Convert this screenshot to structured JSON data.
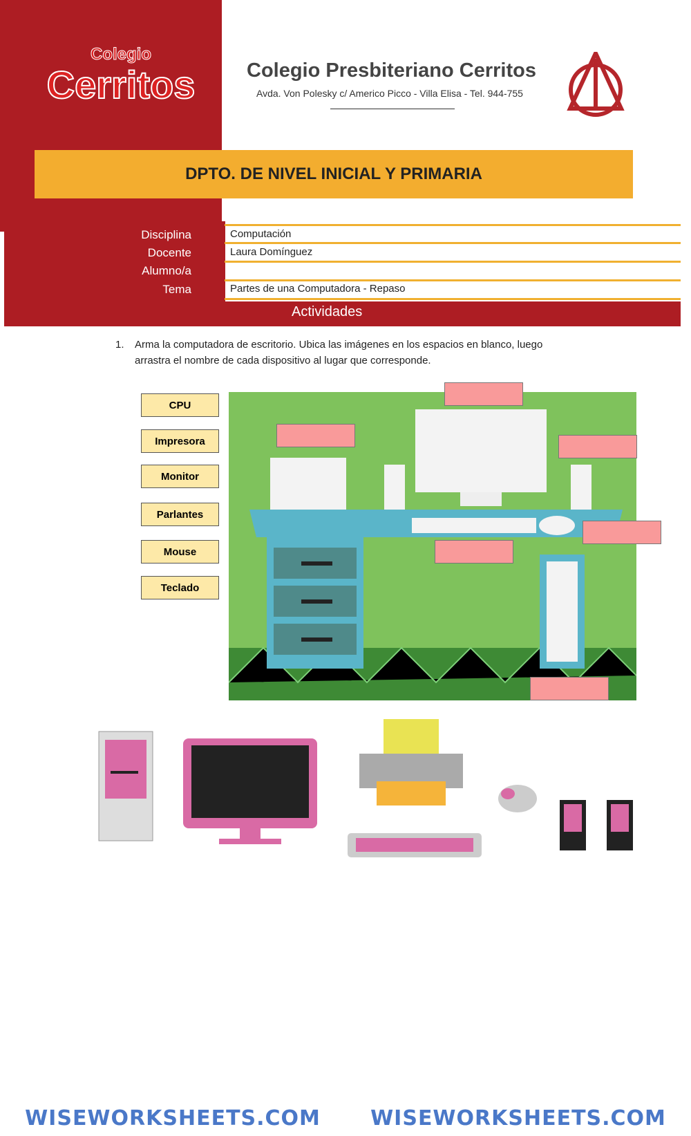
{
  "header": {
    "logo_text_small": "Colegio",
    "logo_text_big": "Cerritos",
    "school_name": "Colegio Presbiteriano Cerritos",
    "address": "Avda. Von Polesky c/ Americo Picco - Villa Elisa - Tel. 944-755",
    "department": "DPTO. DE NIVEL INICIAL Y PRIMARIA"
  },
  "fields": [
    {
      "label": "Disciplina",
      "value": "Computación"
    },
    {
      "label": "Docente",
      "value": "Laura Domínguez"
    },
    {
      "label": "Alumno/a",
      "value": ""
    },
    {
      "label": "Tema",
      "value": "Partes de una Computadora - Repaso"
    }
  ],
  "section": "Actividades",
  "instruction": {
    "number": "1.",
    "line1": "Arma la computadora de escritorio. Ubica las imágenes en los espacios en blanco, luego",
    "line2": "arrastra el nombre de cada dispositivo al lugar que corresponde."
  },
  "words": [
    "CPU",
    "Impresora",
    "Monitor",
    "Parlantes",
    "Mouse",
    "Teclado"
  ],
  "colors": {
    "red": "#ad1d23",
    "orange": "#f3ad2f",
    "drop": "#f99a9a",
    "word": "#fde9a8",
    "wall": "#7fc25c",
    "desk": "#5ab5c9"
  },
  "footer": "WISEWORKSHEETS.COM"
}
